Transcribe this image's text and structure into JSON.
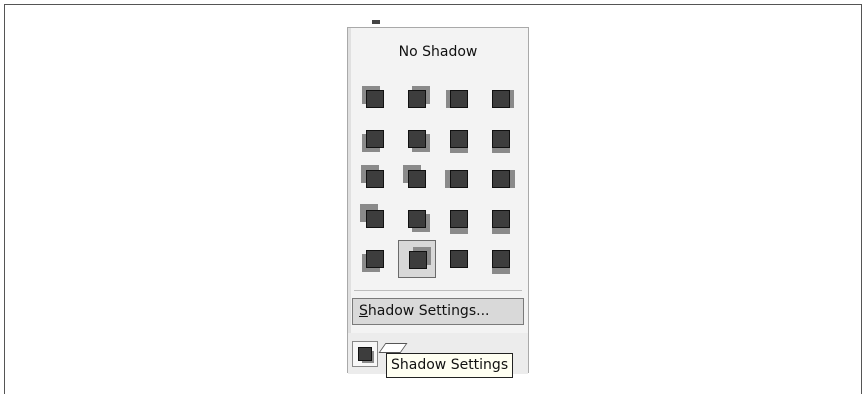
{
  "menu": {
    "no_shadow_label": "No Shadow",
    "shadow_settings_label_accel": "S",
    "shadow_settings_label_rest": "hadow Settings...",
    "selected_style": "shadow-style-18"
  },
  "tooltip": {
    "text": "Shadow Settings"
  },
  "icons": {
    "toolbar_button": "shadow-icon",
    "extra_button": "parallelogram-icon"
  },
  "colors": {
    "panel_bg": "#f3f3f3",
    "shape_fill": "#3d3d3d",
    "shadow": "#8a8a8a",
    "tooltip_bg": "#fffff2"
  }
}
